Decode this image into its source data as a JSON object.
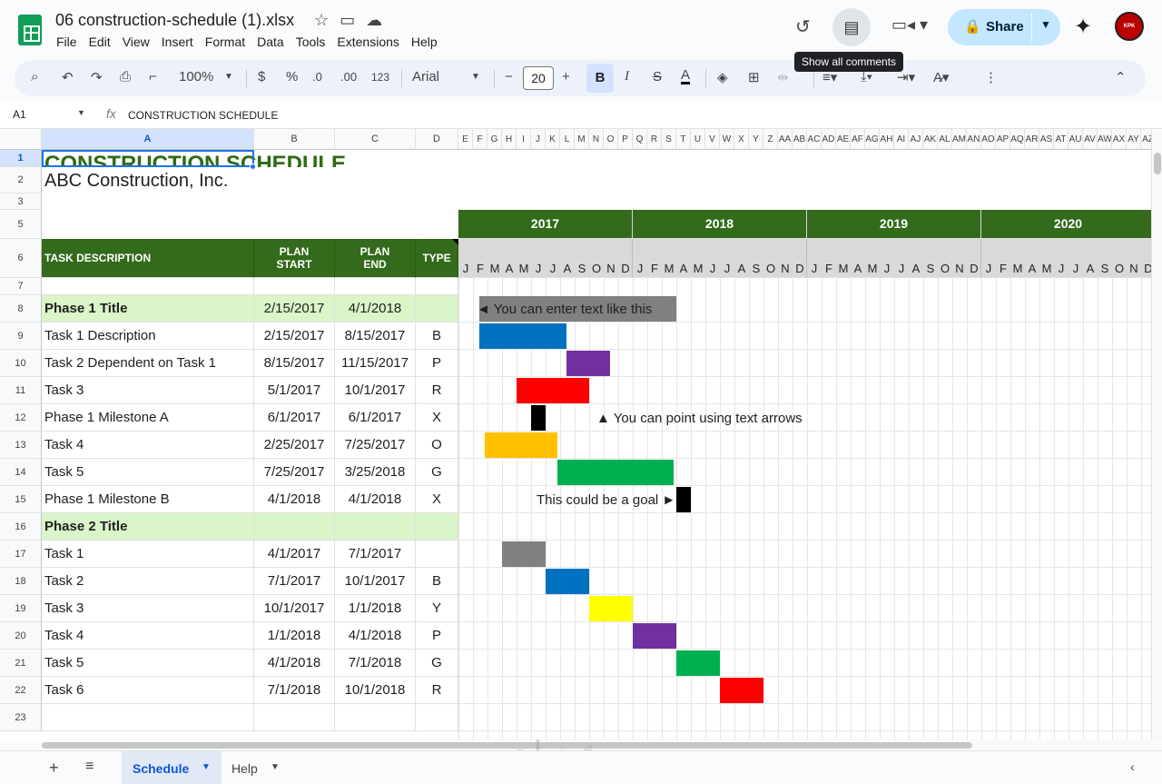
{
  "doc": {
    "title": "06 construction-schedule (1).xlsx",
    "menu": [
      "File",
      "Edit",
      "View",
      "Insert",
      "Format",
      "Data",
      "Tools",
      "Extensions",
      "Help"
    ],
    "share_label": "Share",
    "tooltip": "Show all comments",
    "avatar_text": "KPK"
  },
  "toolbar": {
    "zoom": "100%",
    "currency": "$",
    "percent": "%",
    "dec_less": ".0",
    "dec_more": ".00",
    "number_format": "123",
    "font": "Arial",
    "font_size": "20",
    "bold": "B",
    "italic": "I",
    "strike": "S",
    "text_color": "A"
  },
  "formula_bar": {
    "cell_ref": "A1",
    "fx": "fx",
    "content": "CONSTRUCTION SCHEDULE"
  },
  "columns": {
    "main": [
      "A",
      "B",
      "C",
      "D"
    ],
    "narrow": [
      "E",
      "F",
      "G",
      "H",
      "I",
      "J",
      "K",
      "L",
      "M",
      "N",
      "O",
      "P",
      "Q",
      "R",
      "S",
      "T",
      "U",
      "V",
      "W",
      "X",
      "Y",
      "Z",
      "AA",
      "AB",
      "AC",
      "AD",
      "AE",
      "AF",
      "AG",
      "AH",
      "AI",
      "AJ",
      "AK",
      "AL",
      "AM",
      "AN",
      "AO",
      "AP",
      "AQ",
      "AR",
      "AS",
      "AT",
      "AU",
      "AV",
      "AW",
      "AX",
      "AY",
      "AZ"
    ]
  },
  "rows": [
    "1",
    "2",
    "3",
    "5",
    "6",
    "7",
    "8",
    "9",
    "10",
    "11",
    "12",
    "13",
    "14",
    "15",
    "16",
    "17",
    "18",
    "19",
    "20",
    "21",
    "22",
    "23"
  ],
  "sheet": {
    "title": "CONSTRUCTION SCHEDULE",
    "company": "ABC Construction, Inc.",
    "headers": {
      "task": "TASK DESCRIPTION",
      "start": "PLAN START",
      "end": "PLAN END",
      "type": "TYPE"
    },
    "years": [
      "2017",
      "2018",
      "2019",
      "2020"
    ],
    "months": [
      "J",
      "F",
      "M",
      "A",
      "M",
      "J",
      "J",
      "A",
      "S",
      "O",
      "N",
      "D"
    ],
    "tasks": [
      {
        "name": "Phase 1 Title",
        "start": "2/15/2017",
        "end": "4/1/2018",
        "type": "",
        "phase": true
      },
      {
        "name": "Task 1 Description",
        "start": "2/15/2017",
        "end": "8/15/2017",
        "type": "B"
      },
      {
        "name": "Task 2 Dependent on Task 1",
        "start": "8/15/2017",
        "end": "11/15/2017",
        "type": "P"
      },
      {
        "name": "Task 3",
        "start": "5/1/2017",
        "end": "10/1/2017",
        "type": "R"
      },
      {
        "name": "Phase 1 Milestone A",
        "start": "6/1/2017",
        "end": "6/1/2017",
        "type": "X"
      },
      {
        "name": "Task 4",
        "start": "2/25/2017",
        "end": "7/25/2017",
        "type": "O"
      },
      {
        "name": "Task 5",
        "start": "7/25/2017",
        "end": "3/25/2018",
        "type": "G"
      },
      {
        "name": "Phase 1 Milestone B",
        "start": "4/1/2018",
        "end": "4/1/2018",
        "type": "X"
      },
      {
        "name": "Phase 2 Title",
        "start": "",
        "end": "",
        "type": "",
        "phase": true
      },
      {
        "name": "Task 1",
        "start": "4/1/2017",
        "end": "7/1/2017",
        "type": ""
      },
      {
        "name": "Task 2",
        "start": "7/1/2017",
        "end": "10/1/2017",
        "type": "B"
      },
      {
        "name": "Task 3",
        "start": "10/1/2017",
        "end": "1/1/2018",
        "type": "Y"
      },
      {
        "name": "Task 4",
        "start": "1/1/2018",
        "end": "4/1/2018",
        "type": "P"
      },
      {
        "name": "Task 5",
        "start": "4/1/2018",
        "end": "7/1/2018",
        "type": "G"
      },
      {
        "name": "Task 6",
        "start": "7/1/2018",
        "end": "10/1/2018",
        "type": "R"
      }
    ],
    "notes": {
      "phase1": "◄ You can enter text like this",
      "milestoneA": "▲ You can point using text arrows",
      "milestoneB": "This could be a goal ►"
    },
    "type_colors": {
      "B": "#0070c0",
      "P": "#7030a0",
      "R": "#ff0000",
      "X": "#000000",
      "O": "#ffc000",
      "G": "#00b050",
      "Y": "#ffff00",
      "none": "#808080"
    }
  },
  "tabs": {
    "active": "Schedule",
    "other": "Help"
  },
  "watermark": "خمسات"
}
